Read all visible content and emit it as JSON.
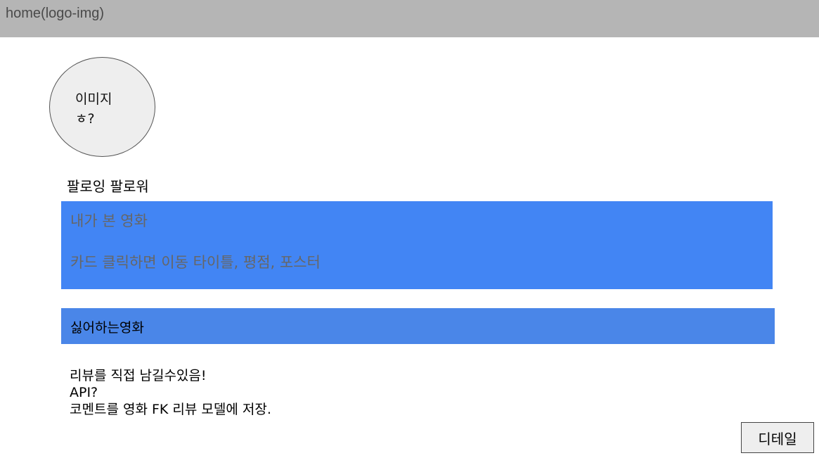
{
  "header": {
    "logo_text": "home(logo-img)"
  },
  "profile": {
    "avatar_label": "이미지ㅎ?",
    "follow_text": "팔로잉 팔로워"
  },
  "watched": {
    "title": "내가 본 영화",
    "description": "카드 클릭하면 이동 타이틀, 평점, 포스터"
  },
  "disliked": {
    "title": "싫어하는영화"
  },
  "review_note": {
    "lines": [
      "리뷰를 직접 남길수있음!",
      "API?",
      "코멘트를 영화 FK 리뷰 모델에 저장."
    ]
  },
  "actions": {
    "detail_label": "디테일"
  },
  "colors": {
    "header_bg": "#b5b5b5",
    "watched_bg": "#4285f4",
    "disliked_bg": "#4a86e8",
    "avatar_bg": "#eeeeee"
  }
}
